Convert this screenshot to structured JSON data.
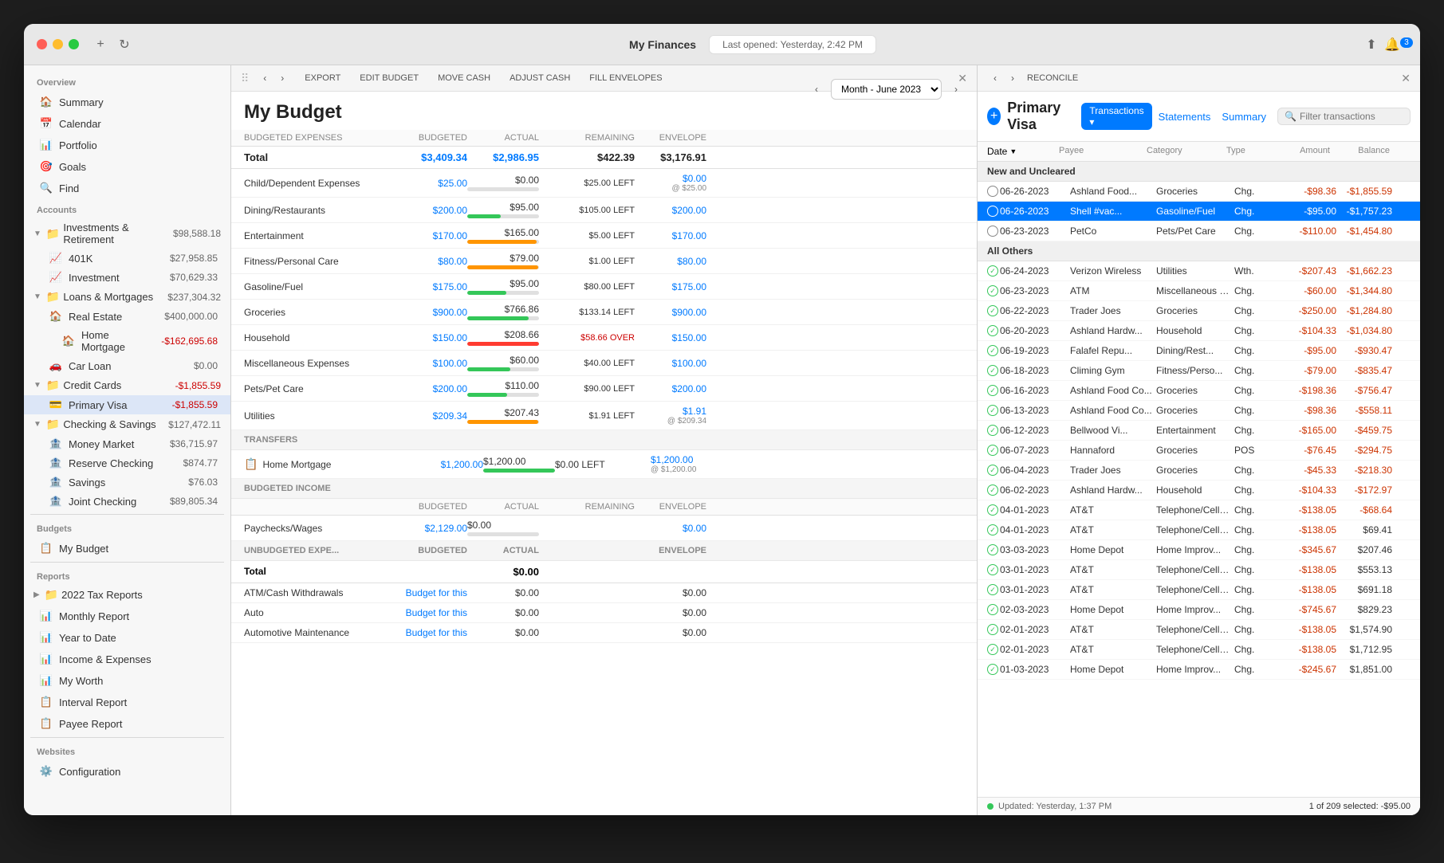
{
  "window": {
    "title": "My Finances",
    "last_opened": "Last opened: Yesterday, 2:42 PM"
  },
  "sidebar": {
    "overview_header": "Overview",
    "overview_items": [
      {
        "label": "Summary",
        "icon": "🏠"
      },
      {
        "label": "Calendar",
        "icon": "📅"
      },
      {
        "label": "Portfolio",
        "icon": "📊"
      },
      {
        "label": "Goals",
        "icon": "🎯"
      },
      {
        "label": "Find",
        "icon": "🔍"
      }
    ],
    "accounts_header": "Accounts",
    "account_groups": [
      {
        "label": "Investments & Retirement",
        "value": "$98,588.18",
        "negative": false,
        "expanded": true,
        "children": [
          {
            "label": "401K",
            "value": "$27,958.85",
            "negative": false,
            "icon": "📈"
          },
          {
            "label": "Investment",
            "value": "$70,629.33",
            "negative": false,
            "icon": "📈"
          }
        ]
      },
      {
        "label": "Loans & Mortgages",
        "value": "$237,304.32",
        "negative": false,
        "expanded": true,
        "children": [
          {
            "label": "Real Estate",
            "value": "$400,000.00",
            "negative": false,
            "icon": "🏠",
            "children": [
              {
                "label": "Home Mortgage",
                "value": "-$162,695.68",
                "negative": true,
                "icon": "🏠"
              }
            ]
          },
          {
            "label": "Car Loan",
            "value": "$0.00",
            "negative": false,
            "icon": "🚗"
          }
        ]
      },
      {
        "label": "Credit Cards",
        "value": "-$1,855.59",
        "negative": true,
        "expanded": true,
        "children": [
          {
            "label": "Primary Visa",
            "value": "-$1,855.59",
            "negative": true,
            "icon": "💳",
            "selected": true
          }
        ]
      },
      {
        "label": "Checking & Savings",
        "value": "$127,472.11",
        "negative": false,
        "expanded": true,
        "children": [
          {
            "label": "Money Market",
            "value": "$36,715.97",
            "negative": false,
            "icon": "🏦"
          },
          {
            "label": "Reserve Checking",
            "value": "$874.77",
            "negative": false,
            "icon": "🏦"
          },
          {
            "label": "Savings",
            "value": "$76.03",
            "negative": false,
            "icon": "🏦"
          },
          {
            "label": "Joint Checking",
            "value": "$89,805.34",
            "negative": false,
            "icon": "🏦"
          }
        ]
      }
    ],
    "budgets_header": "Budgets",
    "budgets_items": [
      {
        "label": "My Budget",
        "icon": "📋"
      }
    ],
    "reports_header": "Reports",
    "reports_items": [
      {
        "label": "2022 Tax Reports",
        "icon": "📁"
      },
      {
        "label": "Monthly Report",
        "icon": "📊"
      },
      {
        "label": "Year to Date",
        "icon": "📊"
      },
      {
        "label": "Income & Expenses",
        "icon": "📊"
      },
      {
        "label": "My Worth",
        "icon": "📊"
      },
      {
        "label": "Interval Report",
        "icon": "📋"
      },
      {
        "label": "Payee Report",
        "icon": "📋"
      }
    ],
    "websites_header": "Websites",
    "websites_items": [
      {
        "label": "Configuration",
        "icon": "⚙️"
      }
    ]
  },
  "budget": {
    "title": "My Budget",
    "month": "Month - June 2023",
    "toolbar": {
      "export": "EXPORT",
      "edit_budget": "EDIT BUDGET",
      "move_cash": "MOVE CASH",
      "adjust_cash": "ADJUST CASH",
      "fill_envelopes": "FILL ENVELOPES"
    },
    "col_headers": {
      "category": "BUDGETED EXPENSES",
      "budgeted": "BUDGETED",
      "actual": "ACTUAL",
      "remaining": "REMAINING",
      "envelope": "ENVELOPE"
    },
    "totals": {
      "label": "Total",
      "budgeted": "$3,409.34",
      "actual": "$2,986.95",
      "remaining": "$422.39",
      "envelope": "$3,176.91"
    },
    "expense_rows": [
      {
        "label": "Child/Dependent Expenses",
        "budgeted": "$25.00",
        "actual": "$0.00",
        "remaining": "$25.00 LEFT",
        "remaining_type": "left",
        "envelope": "$0.00",
        "envelope_note": "@ $25.00",
        "progress": 0,
        "bar_color": "green"
      },
      {
        "label": "Dining/Restaurants",
        "budgeted": "$200.00",
        "actual": "$95.00",
        "remaining": "$105.00 LEFT",
        "remaining_type": "left",
        "envelope": "$200.00",
        "envelope_note": "",
        "progress": 47,
        "bar_color": "green"
      },
      {
        "label": "Entertainment",
        "budgeted": "$170.00",
        "actual": "$165.00",
        "remaining": "$5.00 LEFT",
        "remaining_type": "left",
        "envelope": "$170.00",
        "envelope_note": "",
        "progress": 97,
        "bar_color": "orange"
      },
      {
        "label": "Fitness/Personal Care",
        "budgeted": "$80.00",
        "actual": "$79.00",
        "remaining": "$1.00 LEFT",
        "remaining_type": "left",
        "envelope": "$80.00",
        "envelope_note": "",
        "progress": 99,
        "bar_color": "orange"
      },
      {
        "label": "Gasoline/Fuel",
        "budgeted": "$175.00",
        "actual": "$95.00",
        "remaining": "$80.00 LEFT",
        "remaining_type": "left",
        "envelope": "$175.00",
        "envelope_note": "",
        "progress": 54,
        "bar_color": "green"
      },
      {
        "label": "Groceries",
        "budgeted": "$900.00",
        "actual": "$766.86",
        "remaining": "$133.14 LEFT",
        "remaining_type": "left",
        "envelope": "$900.00",
        "envelope_note": "",
        "progress": 85,
        "bar_color": "green"
      },
      {
        "label": "Household",
        "budgeted": "$150.00",
        "actual": "$208.66",
        "remaining": "$58.66 OVER",
        "remaining_type": "over",
        "envelope": "$150.00",
        "envelope_note": "",
        "progress": 100,
        "bar_color": "red"
      },
      {
        "label": "Miscellaneous Expenses",
        "budgeted": "$100.00",
        "actual": "$60.00",
        "remaining": "$40.00 LEFT",
        "remaining_type": "left",
        "envelope": "$100.00",
        "envelope_note": "",
        "progress": 60,
        "bar_color": "green"
      },
      {
        "label": "Pets/Pet Care",
        "budgeted": "$200.00",
        "actual": "$110.00",
        "remaining": "$90.00 LEFT",
        "remaining_type": "left",
        "envelope": "$200.00",
        "envelope_note": "",
        "progress": 55,
        "bar_color": "green"
      },
      {
        "label": "Utilities",
        "budgeted": "$209.34",
        "actual": "$207.43",
        "remaining": "$1.91 LEFT",
        "remaining_type": "left",
        "envelope": "$1.91",
        "envelope_note": "@ $209.34",
        "progress": 99,
        "bar_color": "orange"
      }
    ],
    "transfers_header": "TRANSFERS",
    "transfer_rows": [
      {
        "label": "Home Mortgage",
        "budgeted": "$1,200.00",
        "actual": "$1,200.00",
        "remaining": "$0.00 LEFT",
        "remaining_type": "left",
        "envelope": "$1,200.00",
        "envelope_note": "@ $1,200.00",
        "progress": 100,
        "bar_color": "green"
      }
    ],
    "income_section": {
      "header": "BUDGETED INCOME",
      "col_headers": {
        "budgeted": "BUDGETED",
        "actual": "ACTUAL",
        "remaining": "REMAINING",
        "envelope": "ENVELOPE"
      },
      "rows": [
        {
          "label": "Paychecks/Wages",
          "budgeted": "$2,129.00",
          "actual": "$0.00",
          "remaining": "",
          "envelope": "$0.00",
          "progress": 0,
          "bar_color": "green"
        }
      ]
    },
    "unbudgeted_section": {
      "header": "UNBUDGETED EXPE...",
      "col_headers": {
        "budgeted": "BUDGETED",
        "actual": "ACTUAL",
        "envelope": "ENVELOPE"
      },
      "total_label": "Total",
      "total_actual": "$0.00",
      "rows": [
        {
          "label": "ATM/Cash Withdrawals",
          "budget_link": "Budget for this",
          "actual": "$0.00",
          "envelope": "$0.00"
        },
        {
          "label": "Auto",
          "budget_link": "Budget for this",
          "actual": "$0.00",
          "envelope": "$0.00"
        },
        {
          "label": "Automotive Maintenance",
          "budget_link": "Budget for this",
          "actual": "$0.00",
          "envelope": "$0.00"
        }
      ]
    }
  },
  "transactions": {
    "account_name": "Primary Visa",
    "tab": "Transactions",
    "statements_link": "Statements",
    "summary_link": "Summary",
    "filter_placeholder": "Filter transactions",
    "reconcile_btn": "RECONCILE",
    "col_headers": {
      "date": "Date",
      "payee": "Payee",
      "category": "Category",
      "type": "Type",
      "amount": "Amount",
      "balance": "Balance"
    },
    "groups": [
      {
        "label": "New and Uncleared",
        "rows": [
          {
            "check": "open",
            "date": "06-26-2023",
            "payee": "Ashland Food...",
            "category": "Groceries",
            "type": "Chg.",
            "amount": "-$98.36",
            "balance": "-$1,855.59",
            "negative": true,
            "selected": false
          },
          {
            "check": "open",
            "date": "06-26-2023",
            "payee": "Shell #vac...",
            "category": "Gasoline/Fuel",
            "type": "Chg.",
            "amount": "-$95.00",
            "balance": "-$1,757.23",
            "negative": true,
            "selected": true
          },
          {
            "check": "open",
            "date": "06-23-2023",
            "payee": "PetCo",
            "category": "Pets/Pet Care",
            "type": "Chg.",
            "amount": "-$110.00",
            "balance": "-$1,454.80",
            "negative": true,
            "selected": false
          }
        ]
      },
      {
        "label": "All Others",
        "rows": [
          {
            "check": "checked",
            "date": "06-24-2023",
            "payee": "Verizon Wireless",
            "category": "Utilities",
            "type": "Wth.",
            "amount": "-$207.43",
            "balance": "-$1,662.23",
            "negative": true,
            "selected": false
          },
          {
            "check": "checked",
            "date": "06-23-2023",
            "payee": "ATM",
            "category": "Miscellaneous Expens...",
            "type": "Chg.",
            "amount": "-$60.00",
            "balance": "-$1,344.80",
            "negative": true,
            "selected": false
          },
          {
            "check": "checked",
            "date": "06-22-2023",
            "payee": "Trader Joes",
            "category": "Groceries",
            "type": "Chg.",
            "amount": "-$250.00",
            "balance": "-$1,284.80",
            "negative": true,
            "selected": false
          },
          {
            "check": "checked",
            "date": "06-20-2023",
            "payee": "Ashland Hardw...",
            "category": "Household",
            "type": "Chg.",
            "amount": "-$104.33",
            "balance": "-$1,034.80",
            "negative": true,
            "selected": false
          },
          {
            "check": "checked",
            "date": "06-19-2023",
            "payee": "Falafel Repu...",
            "category": "Dining/Rest...",
            "type": "Chg.",
            "amount": "-$95.00",
            "balance": "-$930.47",
            "negative": true,
            "selected": false
          },
          {
            "check": "checked",
            "date": "06-18-2023",
            "payee": "Climing Gym",
            "category": "Fitness/Perso...",
            "type": "Chg.",
            "amount": "-$79.00",
            "balance": "-$835.47",
            "negative": true,
            "selected": false
          },
          {
            "check": "checked",
            "date": "06-16-2023",
            "payee": "Ashland Food Co...",
            "category": "Groceries",
            "type": "Chg.",
            "amount": "-$198.36",
            "balance": "-$756.47",
            "negative": true,
            "selected": false
          },
          {
            "check": "checked",
            "date": "06-13-2023",
            "payee": "Ashland Food Co...",
            "category": "Groceries",
            "type": "Chg.",
            "amount": "-$98.36",
            "balance": "-$558.11",
            "negative": true,
            "selected": false
          },
          {
            "check": "checked",
            "date": "06-12-2023",
            "payee": "Bellwood Vi...",
            "category": "Entertainment",
            "type": "Chg.",
            "amount": "-$165.00",
            "balance": "-$459.75",
            "negative": true,
            "selected": false
          },
          {
            "check": "checked",
            "date": "06-07-2023",
            "payee": "Hannaford",
            "category": "Groceries",
            "type": "POS",
            "amount": "-$76.45",
            "balance": "-$294.75",
            "negative": true,
            "selected": false
          },
          {
            "check": "checked",
            "date": "06-04-2023",
            "payee": "Trader Joes",
            "category": "Groceries",
            "type": "Chg.",
            "amount": "-$45.33",
            "balance": "-$218.30",
            "negative": true,
            "selected": false
          },
          {
            "check": "checked",
            "date": "06-02-2023",
            "payee": "Ashland Hardw...",
            "category": "Household",
            "type": "Chg.",
            "amount": "-$104.33",
            "balance": "-$172.97",
            "negative": true,
            "selected": false
          },
          {
            "check": "checked",
            "date": "04-01-2023",
            "payee": "AT&T",
            "category": "Telephone/Cellular",
            "type": "Chg.",
            "amount": "-$138.05",
            "balance": "-$68.64",
            "negative": true,
            "selected": false
          },
          {
            "check": "checked",
            "date": "04-01-2023",
            "payee": "AT&T",
            "category": "Telephone/Cellular",
            "type": "Chg.",
            "amount": "-$138.05",
            "balance": "$69.41",
            "negative": false,
            "selected": false
          },
          {
            "check": "checked",
            "date": "03-03-2023",
            "payee": "Home Depot",
            "category": "Home Improv...",
            "type": "Chg.",
            "amount": "-$345.67",
            "balance": "$207.46",
            "negative": true,
            "selected": false
          },
          {
            "check": "checked",
            "date": "03-01-2023",
            "payee": "AT&T",
            "category": "Telephone/Cellular",
            "type": "Chg.",
            "amount": "-$138.05",
            "balance": "$553.13",
            "negative": true,
            "selected": false
          },
          {
            "check": "checked",
            "date": "03-01-2023",
            "payee": "AT&T",
            "category": "Telephone/Cellular",
            "type": "Chg.",
            "amount": "-$138.05",
            "balance": "$691.18",
            "negative": true,
            "selected": false
          },
          {
            "check": "checked",
            "date": "02-03-2023",
            "payee": "Home Depot",
            "category": "Home Improv...",
            "type": "Chg.",
            "amount": "-$745.67",
            "balance": "$829.23",
            "negative": true,
            "selected": false
          },
          {
            "check": "checked",
            "date": "02-01-2023",
            "payee": "AT&T",
            "category": "Telephone/Cellular",
            "type": "Chg.",
            "amount": "-$138.05",
            "balance": "$1,574.90",
            "negative": true,
            "selected": false
          },
          {
            "check": "checked",
            "date": "02-01-2023",
            "payee": "AT&T",
            "category": "Telephone/Cellular",
            "type": "Chg.",
            "amount": "-$138.05",
            "balance": "$1,712.95",
            "negative": true,
            "selected": false
          },
          {
            "check": "checked",
            "date": "01-03-2023",
            "payee": "Home Depot",
            "category": "Home Improv...",
            "type": "Chg.",
            "amount": "-$245.67",
            "balance": "$1,851.00",
            "negative": true,
            "selected": false
          }
        ]
      }
    ],
    "status": {
      "updated": "Updated: Yesterday, 1:37 PM",
      "selected_info": "1 of 209 selected: -$95.00"
    }
  }
}
